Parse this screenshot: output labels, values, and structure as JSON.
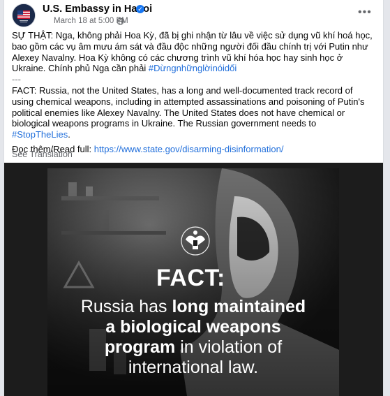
{
  "post": {
    "page_name": "U.S. Embassy in Hanoi",
    "timestamp": "March 18 at 5:00 PM",
    "audience_icon": "globe-icon",
    "more_icon": "more-options-icon",
    "vi_text": "SỰ THẬT: Nga, không phải Hoa Kỳ, đã bị ghi nhận từ lâu về việc sử dụng vũ khí hoá học, bao gồm các vụ âm mưu ám sát và đầu độc những người đối đầu chính trị với Putin như Alexey Navalny. Hoa Kỳ không có các chương trình vũ khí hóa học hay sinh học ở Ukraine. Chính phủ Nga cần phải",
    "vi_hashtag": "#Dừngnhữnglờinóidối",
    "separator": "---",
    "en_text": "FACT: Russia, not the United States, has a long and well-documented track record of using chemical weapons, including in attempted assassinations and poisoning of Putin's political enemies like Alexey Navalny. The United States does not have chemical or biological weapons programs in Ukraine. The Russian government needs to",
    "en_hashtag": "#StopTheLies",
    "en_period": ".",
    "read_more_label": "Đọc thêm/Read full:",
    "read_more_url": "https://www.state.gov/disarming-disinformation/",
    "see_translation": "See Translation"
  },
  "image": {
    "heading": "FACT:",
    "line1_a": "Russia has ",
    "line1_b": "long maintained",
    "line2": "a biological weapons",
    "line3_a": "program",
    "line3_b": " in violation of",
    "line4": "international law.",
    "emblem_icon": "eagle-seal-icon"
  },
  "colors": {
    "link": "#216fdb",
    "secondary_text": "#65676b",
    "verified": "#1877f2"
  }
}
